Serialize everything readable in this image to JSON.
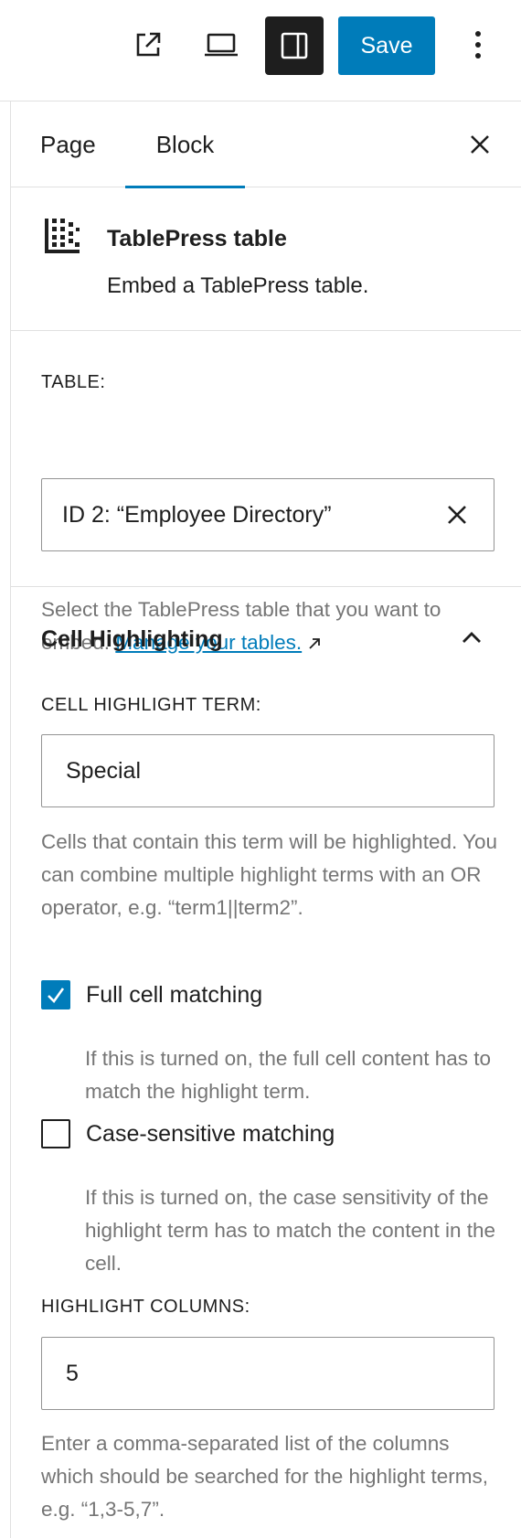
{
  "toolbar": {
    "view_post_icon": "external-link-icon",
    "preview_icon": "laptop-icon",
    "settings_icon": "sidebar-icon",
    "save_label": "Save",
    "more_icon": "vertical-dots-icon"
  },
  "tabs": {
    "page_label": "Page",
    "block_label": "Block",
    "close_icon": "close-icon"
  },
  "block": {
    "icon": "tablepress-icon",
    "title": "TablePress table",
    "description": "Embed a TablePress table."
  },
  "table_section": {
    "label": "TABLE:",
    "selected_value": "ID 2: “Employee Directory”",
    "help_text": "Select the TablePress table that you want to embed. ",
    "manage_link": "Manage your tables."
  },
  "cell_highlighting": {
    "title": "Cell Highlighting",
    "term_label": "CELL HIGHLIGHT TERM:",
    "term_value": "Special",
    "term_help": "Cells that contain this term will be highlighted. You can combine multiple highlight terms with an OR operator, e.g. “term1||term2”.",
    "full_cell": {
      "label": "Full cell matching",
      "checked": true,
      "help": "If this is turned on, the full cell content has to match the highlight term."
    },
    "case_sensitive": {
      "label": "Case-sensitive matching",
      "checked": false,
      "help": "If this is turned on, the case sensitivity of the highlight term has to match the content in the cell."
    },
    "columns_label": "HIGHLIGHT COLUMNS:",
    "columns_value": "5",
    "columns_help": "Enter a comma-separated list of the columns which should be searched for the highlight terms, e.g. “1,3-5,7”."
  },
  "colors": {
    "accent": "#007cba",
    "text": "#1e1e1e",
    "muted": "#757575",
    "border": "#e0e0e0"
  }
}
